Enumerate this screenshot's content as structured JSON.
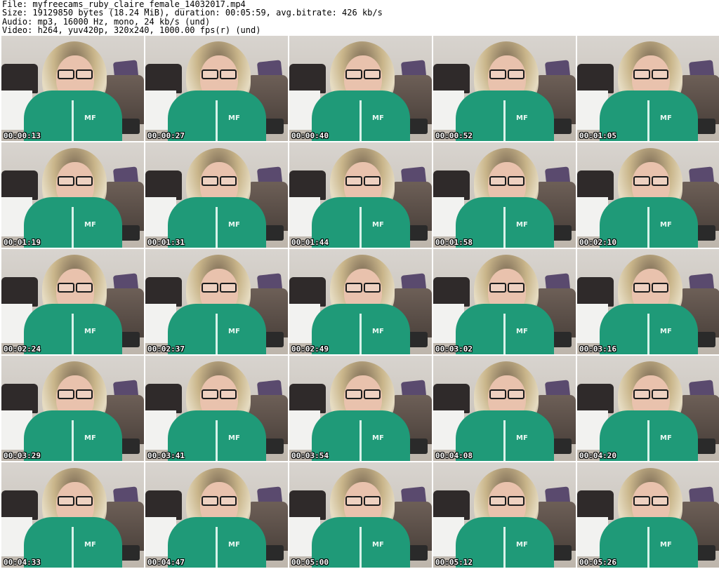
{
  "header": {
    "file": "File: myfreecams_ruby_claire_female_14032017.mp4",
    "size": "Size: 19129850 bytes (18.24 MiB), duration: 00:05:59, avg.bitrate: 426 kb/s",
    "audio": "Audio: mp3, 16000 Hz, mono, 24 kb/s (und)",
    "video": "Video: h264, yuv420p, 320x240, 1000.00 fps(r) (und)"
  },
  "thumbnails": [
    {
      "timestamp": "00:00:13"
    },
    {
      "timestamp": "00:00:27"
    },
    {
      "timestamp": "00:00:40"
    },
    {
      "timestamp": "00:00:52"
    },
    {
      "timestamp": "00:01:05"
    },
    {
      "timestamp": "00:01:19"
    },
    {
      "timestamp": "00:01:31"
    },
    {
      "timestamp": "00:01:44"
    },
    {
      "timestamp": "00:01:58"
    },
    {
      "timestamp": "00:02:10"
    },
    {
      "timestamp": "00:02:24"
    },
    {
      "timestamp": "00:02:37"
    },
    {
      "timestamp": "00:02:49"
    },
    {
      "timestamp": "00:03:02"
    },
    {
      "timestamp": "00:03:16"
    },
    {
      "timestamp": "00:03:29"
    },
    {
      "timestamp": "00:03:41"
    },
    {
      "timestamp": "00:03:54"
    },
    {
      "timestamp": "00:04:08"
    },
    {
      "timestamp": "00:04:20"
    },
    {
      "timestamp": "00:04:33"
    },
    {
      "timestamp": "00:04:47"
    },
    {
      "timestamp": "00:05:00"
    },
    {
      "timestamp": "00:05:12"
    },
    {
      "timestamp": "00:05:26"
    }
  ],
  "hoodie_logo": "MF",
  "colors": {
    "hoodie": "#1f9a78",
    "timestamp_text": "#ffffff",
    "background": "#ffffff"
  }
}
